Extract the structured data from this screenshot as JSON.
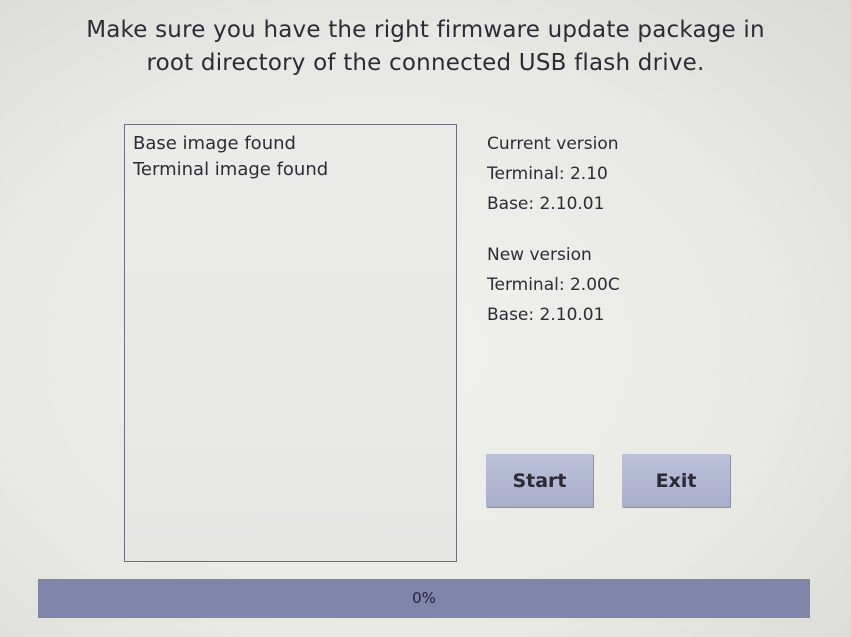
{
  "instruction": {
    "line1": "Make sure you have the right firmware update package in",
    "line2": "root directory of the connected USB flash drive."
  },
  "log": {
    "lines": [
      "Base image found",
      "Terminal image found"
    ]
  },
  "current_version": {
    "heading": "Current version",
    "terminal": "Terminal: 2.10",
    "base": "Base: 2.10.01"
  },
  "new_version": {
    "heading": "New version",
    "terminal": "Terminal: 2.00C",
    "base": "Base: 2.10.01"
  },
  "buttons": {
    "start_label": "Start",
    "exit_label": "Exit"
  },
  "progress": {
    "label": "0%",
    "value": 0
  },
  "colors": {
    "button": "#b4b9d4",
    "progress_bar": "#7f86aa",
    "text": "#2c2c36"
  }
}
